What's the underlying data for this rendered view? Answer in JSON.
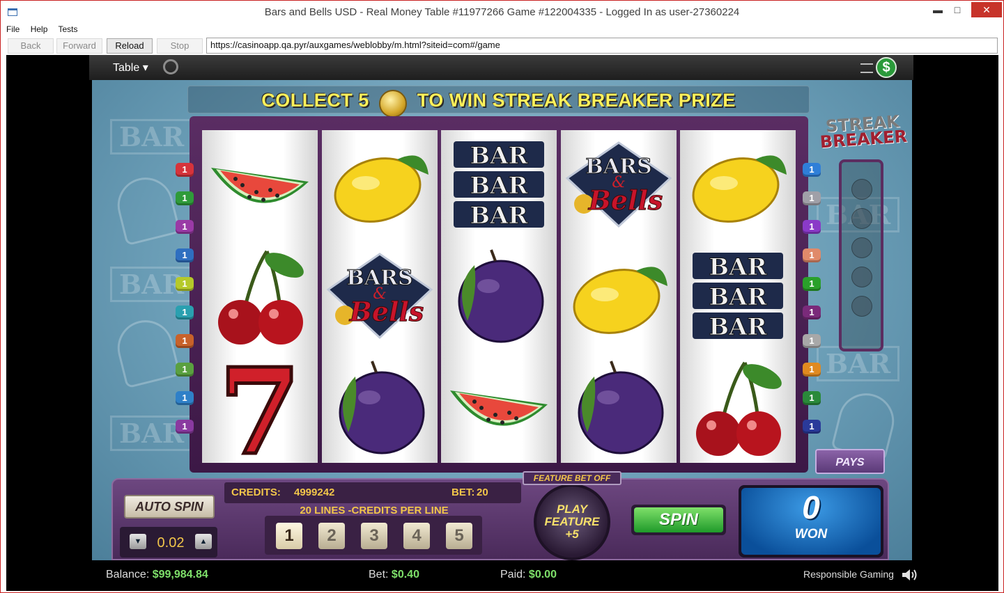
{
  "window": {
    "title": "Bars and Bells USD - Real Money Table #11977266 Game #122004335 - Logged In as user-27360224",
    "minimize": "▬",
    "maximize": "□",
    "close": "✕"
  },
  "menu": [
    "File",
    "Help",
    "Tests"
  ],
  "nav": {
    "back": "Back",
    "forward": "Forward",
    "reload": "Reload",
    "stop": "Stop",
    "url": "https://casinoapp.qa.pyr/auxgames/weblobby/m.html?siteid=com#/game"
  },
  "gamebar": {
    "table_label": "Table ▾",
    "cashier_icon": "$"
  },
  "banner": {
    "before": "COLLECT 5",
    "after": "TO WIN STREAK BREAKER PRIZE"
  },
  "streak_logo": {
    "line1": "STREAK",
    "line2": "BREAKER"
  },
  "reels": [
    [
      "watermelon",
      "cherries",
      "seven"
    ],
    [
      "lemon",
      "bars-and-bells",
      "plum"
    ],
    [
      "triple-bar",
      "plum",
      "watermelon"
    ],
    [
      "bars-and-bells",
      "lemon",
      "plum"
    ],
    [
      "lemon",
      "triple-bar",
      "cherries"
    ]
  ],
  "symbol_text": {
    "bar": "BAR",
    "bars": "BARS",
    "amp": "&",
    "bells": "Bells",
    "seven": "7"
  },
  "line_tags_left": [
    {
      "label": "1",
      "color": "#d6333b"
    },
    {
      "label": "1",
      "color": "#2f9b3a"
    },
    {
      "label": "1",
      "color": "#9a3aa6"
    },
    {
      "label": "1",
      "color": "#2f6fc0"
    },
    {
      "label": "1",
      "color": "#b5c92a"
    },
    {
      "label": "1",
      "color": "#2aa0b0"
    },
    {
      "label": "1",
      "color": "#c8622a"
    },
    {
      "label": "1",
      "color": "#5aa040"
    },
    {
      "label": "1",
      "color": "#2f80c8"
    },
    {
      "label": "1",
      "color": "#8a3aa0"
    }
  ],
  "line_tags_right": [
    {
      "label": "1",
      "color": "#2f7fd8"
    },
    {
      "label": "1",
      "color": "#a0a0a8"
    },
    {
      "label": "1",
      "color": "#8a3ac8"
    },
    {
      "label": "1",
      "color": "#e08a6a"
    },
    {
      "label": "1",
      "color": "#2aa02a"
    },
    {
      "label": "1",
      "color": "#7a2a7a"
    },
    {
      "label": "1",
      "color": "#a8a8a8"
    },
    {
      "label": "1",
      "color": "#e08a20"
    },
    {
      "label": "1",
      "color": "#2a8a3a"
    },
    {
      "label": "1",
      "color": "#2a3a9a"
    }
  ],
  "pays_button": "PAYS",
  "controls": {
    "auto_spin": "AUTO SPIN",
    "denomination": "0.02",
    "credits_label": "CREDITS:",
    "credits_value": "4999242",
    "bet_label": "BET:",
    "bet_value": "20",
    "lines_label": "20 LINES -CREDITS PER LINE",
    "line_options": [
      "1",
      "2",
      "3",
      "4",
      "5"
    ],
    "feature_bet": "FEATURE BET OFF",
    "play_feature": [
      "PLAY",
      "FEATURE",
      "+5"
    ],
    "spin": "SPIN",
    "won_value": "0",
    "won_label": "WON"
  },
  "footer": {
    "balance_label": "Balance:",
    "balance_value": "$99,984.84",
    "bet_label": "Bet:",
    "bet_value": "$0.40",
    "paid_label": "Paid:",
    "paid_value": "$0.00",
    "responsible": "Responsible Gaming"
  }
}
